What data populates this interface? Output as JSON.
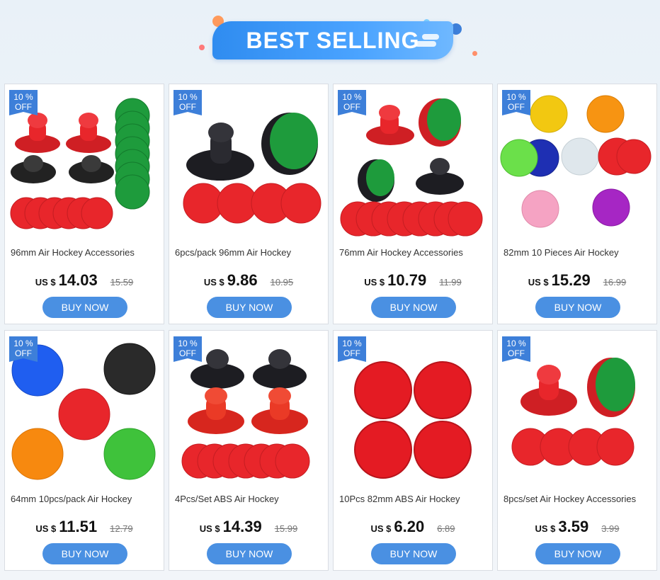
{
  "banner": {
    "title": "BEST SELLING"
  },
  "colors": {
    "accent": "#4a90e2",
    "badge": "#3d7fd9",
    "puck_red": "#e8262b",
    "puck_green": "#1e9b3c"
  },
  "products": [
    {
      "discount_pct": "10 %",
      "discount_off": "OFF",
      "title": "96mm Air Hockey Accessories",
      "currency": "US $",
      "price": "14.03",
      "old_price": "15.59",
      "buy_label": "BUY NOW"
    },
    {
      "discount_pct": "10 %",
      "discount_off": "OFF",
      "title": "6pcs/pack 96mm Air Hockey",
      "currency": "US $",
      "price": "9.86",
      "old_price": "10.95",
      "buy_label": "BUY NOW"
    },
    {
      "discount_pct": "10 %",
      "discount_off": "OFF",
      "title": "76mm Air Hockey Accessories",
      "currency": "US $",
      "price": "10.79",
      "old_price": "11.99",
      "buy_label": "BUY NOW"
    },
    {
      "discount_pct": "10 %",
      "discount_off": "OFF",
      "title": "82mm 10 Pieces Air Hockey",
      "currency": "US $",
      "price": "15.29",
      "old_price": "16.99",
      "buy_label": "BUY NOW"
    },
    {
      "discount_pct": "10 %",
      "discount_off": "OFF",
      "title": "64mm 10pcs/pack Air Hockey",
      "currency": "US $",
      "price": "11.51",
      "old_price": "12.79",
      "buy_label": "BUY NOW"
    },
    {
      "discount_pct": "10 %",
      "discount_off": "OFF",
      "title": "4Pcs/Set ABS Air Hockey",
      "currency": "US $",
      "price": "14.39",
      "old_price": "15.99",
      "buy_label": "BUY NOW"
    },
    {
      "discount_pct": "10 %",
      "discount_off": "OFF",
      "title": "10Pcs 82mm ABS Air Hockey",
      "currency": "US $",
      "price": "6.20",
      "old_price": "6.89",
      "buy_label": "BUY NOW"
    },
    {
      "discount_pct": "10 %",
      "discount_off": "OFF",
      "title": "8pcs/set Air Hockey Accessories",
      "currency": "US $",
      "price": "3.59",
      "old_price": "3.99",
      "buy_label": "BUY NOW"
    }
  ]
}
